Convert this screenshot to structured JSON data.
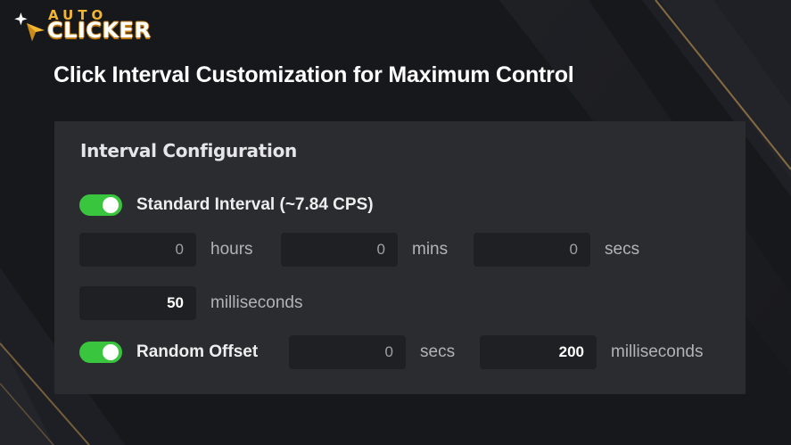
{
  "brand": {
    "logo_top": "AUTO",
    "logo_bottom": "CLICKER",
    "accent": "#f2b632"
  },
  "headline": "Click Interval Customization for Maximum Control",
  "panel": {
    "title": "Interval Configuration",
    "standard": {
      "enabled": true,
      "label": "Standard Interval (~7.84 CPS)",
      "hours_value": "0",
      "hours_label": "hours",
      "mins_value": "0",
      "mins_label": "mins",
      "secs_value": "0",
      "secs_label": "secs",
      "ms_value": "50",
      "ms_label": "milliseconds"
    },
    "random": {
      "enabled": true,
      "label": "Random Offset",
      "secs_value": "0",
      "secs_label": "secs",
      "ms_value": "200",
      "ms_label": "milliseconds"
    }
  },
  "colors": {
    "toggle_on": "#3ac53e",
    "panel_bg": "#2b2c30",
    "field_bg": "#1f2023"
  }
}
